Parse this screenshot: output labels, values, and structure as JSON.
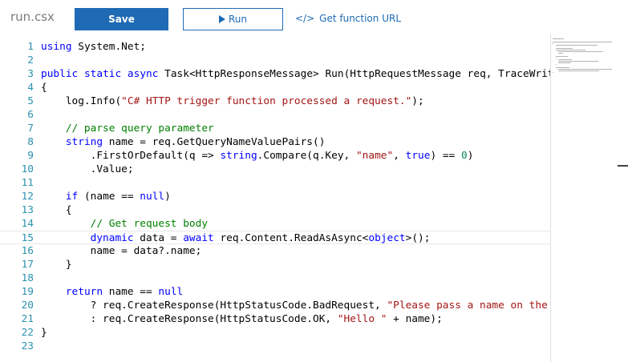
{
  "header": {
    "filename": "run.csx",
    "save_label": "Save",
    "run_label": "Run",
    "url_icon": "</>",
    "url_label": "Get function URL"
  },
  "code_lines": [
    {
      "n": "1",
      "tokens": [
        [
          "kw",
          "using"
        ],
        [
          "",
          "System.Net;"
        ]
      ]
    },
    {
      "n": "2",
      "tokens": []
    },
    {
      "n": "3",
      "tokens": [
        [
          "kw",
          "public"
        ],
        [
          "",
          " "
        ],
        [
          "kw",
          "static"
        ],
        [
          "",
          " "
        ],
        [
          "kw",
          "async"
        ],
        [
          "",
          "Task<HttpResponseMessage> Run(HttpRequestMessage req, TraceWrit"
        ]
      ]
    },
    {
      "n": "4",
      "tokens": [
        [
          "",
          "{"
        ]
      ]
    },
    {
      "n": "5",
      "tokens": [
        [
          "",
          "    log.Info("
        ],
        [
          "str",
          "\"C# HTTP trigger function processed a request.\""
        ],
        [
          "",
          ");"
        ]
      ]
    },
    {
      "n": "6",
      "tokens": []
    },
    {
      "n": "7",
      "tokens": [
        [
          "cm",
          "    // parse query parameter"
        ]
      ]
    },
    {
      "n": "8",
      "tokens": [
        [
          "",
          "    "
        ],
        [
          "kw",
          "string"
        ],
        [
          "",
          " name = req.GetQueryNameValuePairs()"
        ]
      ]
    },
    {
      "n": "9",
      "tokens": [
        [
          "",
          "        .FirstOrDefault(q => "
        ],
        [
          "kw",
          "string"
        ],
        [
          "",
          ".Compare(q.Key, "
        ],
        [
          "str",
          "\"name\""
        ],
        [
          "",
          ", "
        ],
        [
          "kw",
          "true"
        ],
        [
          "",
          ") == "
        ],
        [
          "num",
          "0"
        ],
        [
          "",
          ")"
        ]
      ]
    },
    {
      "n": "10",
      "tokens": [
        [
          "",
          "        .Value;"
        ]
      ]
    },
    {
      "n": "11",
      "tokens": []
    },
    {
      "n": "12",
      "tokens": [
        [
          "",
          "    "
        ],
        [
          "kw",
          "if"
        ],
        [
          "",
          " (name == "
        ],
        [
          "kw",
          "null"
        ],
        [
          "",
          ")"
        ]
      ]
    },
    {
      "n": "13",
      "tokens": [
        [
          "",
          "    {"
        ]
      ]
    },
    {
      "n": "14",
      "tokens": [
        [
          "cm",
          "        // Get request body"
        ]
      ]
    },
    {
      "n": "15",
      "tokens": [
        [
          "",
          "        "
        ],
        [
          "kw",
          "dynamic"
        ],
        [
          "",
          " data = "
        ],
        [
          "kw",
          "await"
        ],
        [
          "",
          " req.Content.ReadAsAsync<"
        ],
        [
          "kw",
          "object"
        ],
        [
          "",
          ">();"
        ]
      ]
    },
    {
      "n": "16",
      "tokens": [
        [
          "",
          "        name = data?.name;"
        ]
      ]
    },
    {
      "n": "17",
      "tokens": [
        [
          "",
          "    }"
        ]
      ]
    },
    {
      "n": "18",
      "tokens": []
    },
    {
      "n": "19",
      "tokens": [
        [
          "",
          "    "
        ],
        [
          "kw",
          "return"
        ],
        [
          "",
          " name == "
        ],
        [
          "kw",
          "null"
        ]
      ]
    },
    {
      "n": "20",
      "tokens": [
        [
          "",
          "        ? req.CreateResponse(HttpStatusCode.BadRequest, "
        ],
        [
          "str",
          "\"Please pass a name on the"
        ]
      ]
    },
    {
      "n": "21",
      "tokens": [
        [
          "",
          "        : req.CreateResponse(HttpStatusCode.OK, "
        ],
        [
          "str",
          "\"Hello \""
        ],
        [
          "",
          " + name);"
        ]
      ]
    },
    {
      "n": "22",
      "tokens": [
        [
          "",
          "}"
        ]
      ]
    },
    {
      "n": "23",
      "tokens": []
    }
  ]
}
